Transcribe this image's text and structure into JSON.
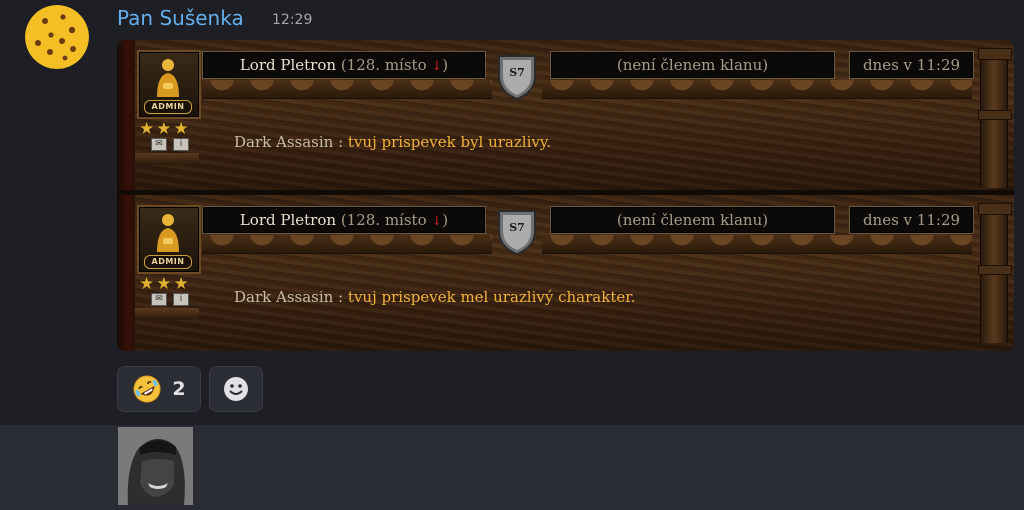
{
  "message": {
    "author": "Pan Sušenka",
    "timestamp": "12:29",
    "author_color": "#64b0ee"
  },
  "posts": [
    {
      "player_name": "Lord Pletron",
      "rank_text": "(128. místo",
      "rank_arrow": "↓",
      "rank_close": ")",
      "badge": "ADMIN",
      "shield": "S7",
      "clan": "(není členem klanu)",
      "date": "dnes v 11:29",
      "text_author": "Dark Assasin",
      "text_sep": " : ",
      "text_body": "tvuj prispevek byl urazlivy.",
      "stars": 3
    },
    {
      "player_name": "Lord Pletron",
      "rank_text": "(128. místo",
      "rank_arrow": "↓",
      "rank_close": ")",
      "badge": "ADMIN",
      "shield": "S7",
      "clan": "(není členem klanu)",
      "date": "dnes v 11:29",
      "text_author": "Dark Assasin",
      "text_sep": " : ",
      "text_body": "tvuj prispevek mel urazlivý charakter.",
      "stars": 3
    }
  ],
  "reactions": [
    {
      "emoji": "rolling-on-floor-laughing",
      "count": "2"
    },
    {
      "emoji": "add-reaction"
    }
  ],
  "colors": {
    "background": "#1e1f24",
    "post_highlight": "#f0b23c",
    "rank_arrow": "#d62020"
  }
}
